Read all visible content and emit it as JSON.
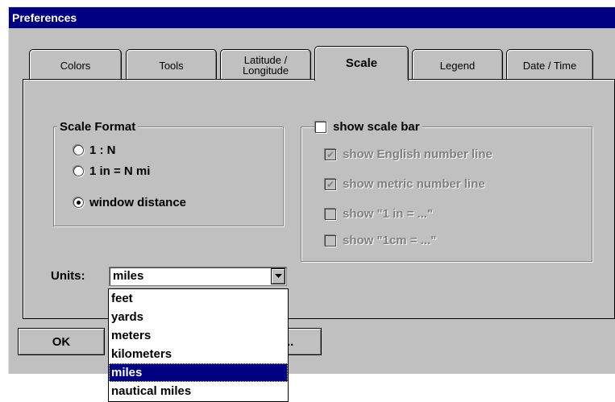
{
  "window": {
    "title": "Preferences"
  },
  "tabs": [
    {
      "label": "Colors",
      "active": false
    },
    {
      "label": "Tools",
      "active": false
    },
    {
      "label": "Latitude /\nLongitude",
      "active": false
    },
    {
      "label": "Scale",
      "active": true
    },
    {
      "label": "Legend",
      "active": false
    },
    {
      "label": "Date / Time",
      "active": false
    }
  ],
  "scale_format": {
    "title": "Scale Format",
    "options": [
      {
        "label": "1 : N",
        "selected": false
      },
      {
        "label": "1 in = N mi",
        "selected": false
      },
      {
        "label": "window distance",
        "selected": true
      }
    ]
  },
  "scale_bar": {
    "title": "show scale bar",
    "checked": false,
    "options": [
      {
        "label": "show English number line",
        "checked": true,
        "enabled": false
      },
      {
        "label": "show metric number line",
        "checked": true,
        "enabled": false
      },
      {
        "label": "show \"1 in = ...\"",
        "checked": false,
        "enabled": false
      },
      {
        "label": "show \"1cm = ...\"",
        "checked": false,
        "enabled": false
      }
    ]
  },
  "units": {
    "label": "Units:",
    "value": "miles",
    "options": [
      "feet",
      "yards",
      "meters",
      "kilometers",
      "miles",
      "nautical miles"
    ],
    "selected_index": 4
  },
  "buttons": {
    "ok": "OK",
    "other": ".."
  },
  "colors": {
    "titlebar": "#000080",
    "face": "#c0c0c0",
    "selection": "#000080"
  }
}
